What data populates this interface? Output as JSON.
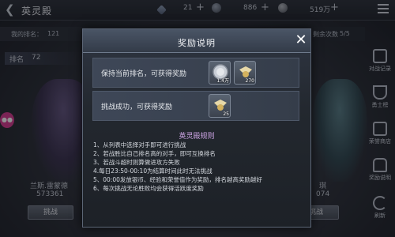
{
  "header": {
    "title": "英灵殿",
    "resources": [
      {
        "name": "gem",
        "icon": "diamond-icon",
        "value": "21"
      },
      {
        "name": "stamina",
        "icon": "orb-icon",
        "value": "886"
      },
      {
        "name": "gold",
        "icon": "coin-icon",
        "value": "519万"
      }
    ]
  },
  "rank_bar": {
    "my_rank_label": "我的排名：",
    "my_rank_value": "121",
    "remaining_label": "剩余次数",
    "remaining_value": "5/5"
  },
  "rank_tag": {
    "label": "排名",
    "value": "72"
  },
  "heroes": [
    {
      "name": "兰斯.雷蒙德",
      "power": "573361"
    },
    {
      "name": "琪",
      "power": "074"
    }
  ],
  "challenge_buttons": [
    "挑战",
    "挑战",
    "挑战",
    "挑战"
  ],
  "side_menu": [
    {
      "label": "对战记录",
      "icon": "scroll-icon"
    },
    {
      "label": "勇士榜",
      "icon": "trophy-icon"
    },
    {
      "label": "荣誉商店",
      "icon": "shop-icon"
    },
    {
      "label": "奖励说明",
      "icon": "chest-icon"
    },
    {
      "label": "刷新",
      "icon": "refresh-icon"
    }
  ],
  "dialog": {
    "title": "奖励说明",
    "close_label": "✕",
    "rewards": [
      {
        "text": "保持当前排名，可获得奖励",
        "items": [
          {
            "icon": "silver-coin-icon",
            "count": "1.4万"
          },
          {
            "icon": "winged-medal-icon",
            "count": "270"
          }
        ]
      },
      {
        "text": "挑战成功，可获得奖励",
        "items": [
          {
            "icon": "winged-medal-icon",
            "count": "25"
          }
        ]
      }
    ],
    "rules_title": "英灵殿规则",
    "rules": [
      "1、从列表中选择对手即可进行挑战",
      "2、若战胜比自己排名高的对手，即可互换排名",
      "3、若战斗超时则算做进攻方失败",
      "4.每日23:50-00:10为结算时间此时无法挑战",
      "5、00:00发放银币、经验和荣誉值作为奖励，排名越高奖励越好",
      "6、每次挑战无论胜败均会获得活跃度奖励"
    ]
  },
  "colors": {
    "rules_title": "#d2a8ea",
    "dialog_border": "#5c6676",
    "marker": "#d53a8e"
  }
}
